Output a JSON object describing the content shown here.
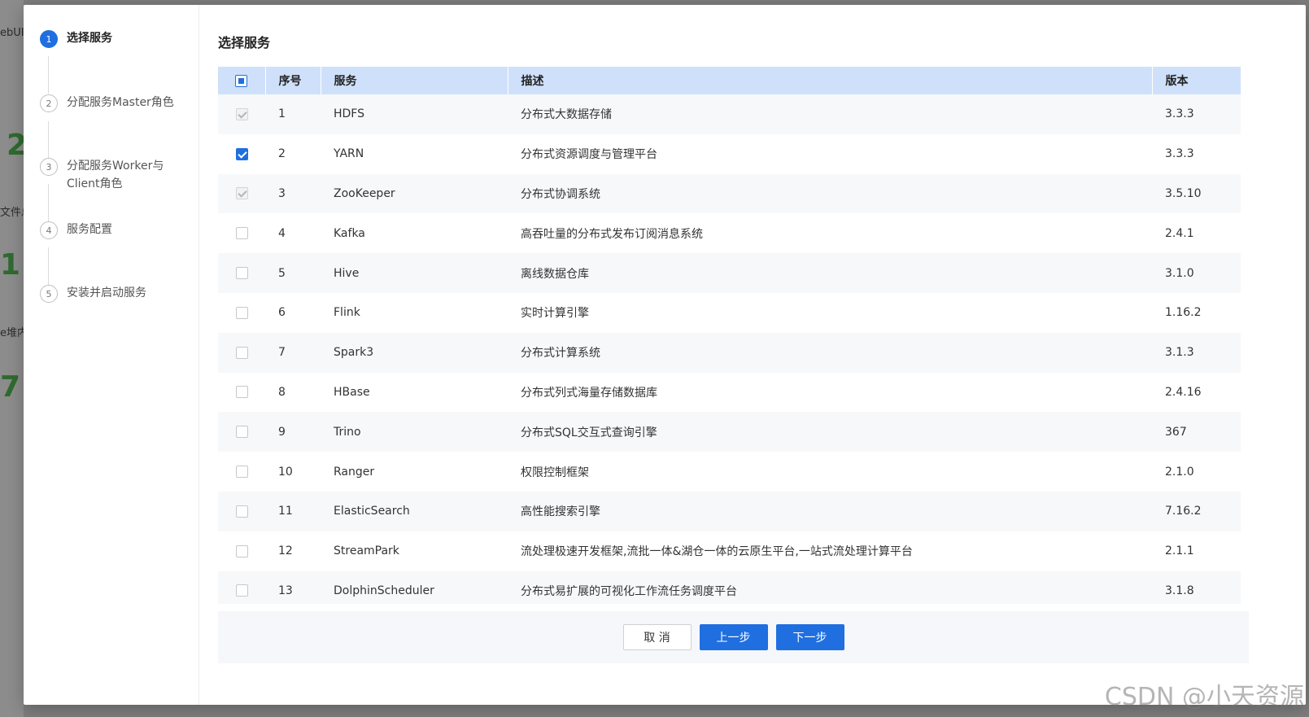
{
  "steps": [
    {
      "num": "1",
      "label": "选择服务"
    },
    {
      "num": "2",
      "label": "分配服务Master角色"
    },
    {
      "num": "3",
      "label": "分配服务Worker与Client角色"
    },
    {
      "num": "4",
      "label": "服务配置"
    },
    {
      "num": "5",
      "label": "安装并启动服务"
    }
  ],
  "content": {
    "title": "选择服务"
  },
  "table": {
    "headers": {
      "index": "序号",
      "service": "服务",
      "description": "描述",
      "version": "版本"
    },
    "rows": [
      {
        "index": "1",
        "service": "HDFS",
        "description": "分布式大数据存储",
        "version": "3.3.3",
        "check": "disabled"
      },
      {
        "index": "2",
        "service": "YARN",
        "description": "分布式资源调度与管理平台",
        "version": "3.3.3",
        "check": "checked"
      },
      {
        "index": "3",
        "service": "ZooKeeper",
        "description": "分布式协调系统",
        "version": "3.5.10",
        "check": "disabled"
      },
      {
        "index": "4",
        "service": "Kafka",
        "description": "高吞吐量的分布式发布订阅消息系统",
        "version": "2.4.1",
        "check": "unchecked"
      },
      {
        "index": "5",
        "service": "Hive",
        "description": "离线数据仓库",
        "version": "3.1.0",
        "check": "unchecked"
      },
      {
        "index": "6",
        "service": "Flink",
        "description": "实时计算引擎",
        "version": "1.16.2",
        "check": "unchecked"
      },
      {
        "index": "7",
        "service": "Spark3",
        "description": "分布式计算系统",
        "version": "3.1.3",
        "check": "unchecked"
      },
      {
        "index": "8",
        "service": "HBase",
        "description": "分布式列式海量存储数据库",
        "version": "2.4.16",
        "check": "unchecked"
      },
      {
        "index": "9",
        "service": "Trino",
        "description": "分布式SQL交互式查询引擎",
        "version": "367",
        "check": "unchecked"
      },
      {
        "index": "10",
        "service": "Ranger",
        "description": "权限控制框架",
        "version": "2.1.0",
        "check": "unchecked"
      },
      {
        "index": "11",
        "service": "ElasticSearch",
        "description": "高性能搜索引擎",
        "version": "7.16.2",
        "check": "unchecked"
      },
      {
        "index": "12",
        "service": "StreamPark",
        "description": "流处理极速开发框架,流批一体&湖仓一体的云原生平台,一站式流处理计算平台",
        "version": "2.1.1",
        "check": "unchecked"
      },
      {
        "index": "13",
        "service": "DolphinScheduler",
        "description": "分布式易扩展的可视化工作流任务调度平台",
        "version": "3.1.8",
        "check": "unchecked"
      }
    ]
  },
  "footer": {
    "cancel": "取 消",
    "prev": "上一步",
    "next": "下一步"
  },
  "background": {
    "t1": "ebUI",
    "t2": "文件总",
    "t3": "e堆内",
    "n1": "2",
    "n2": "1",
    "n3": "7"
  },
  "watermark": "CSDN @小天资源",
  "colors": {
    "primary": "#1f6fe0",
    "header_bg": "#cfe0fa",
    "stripe": "#f7f8fa"
  }
}
